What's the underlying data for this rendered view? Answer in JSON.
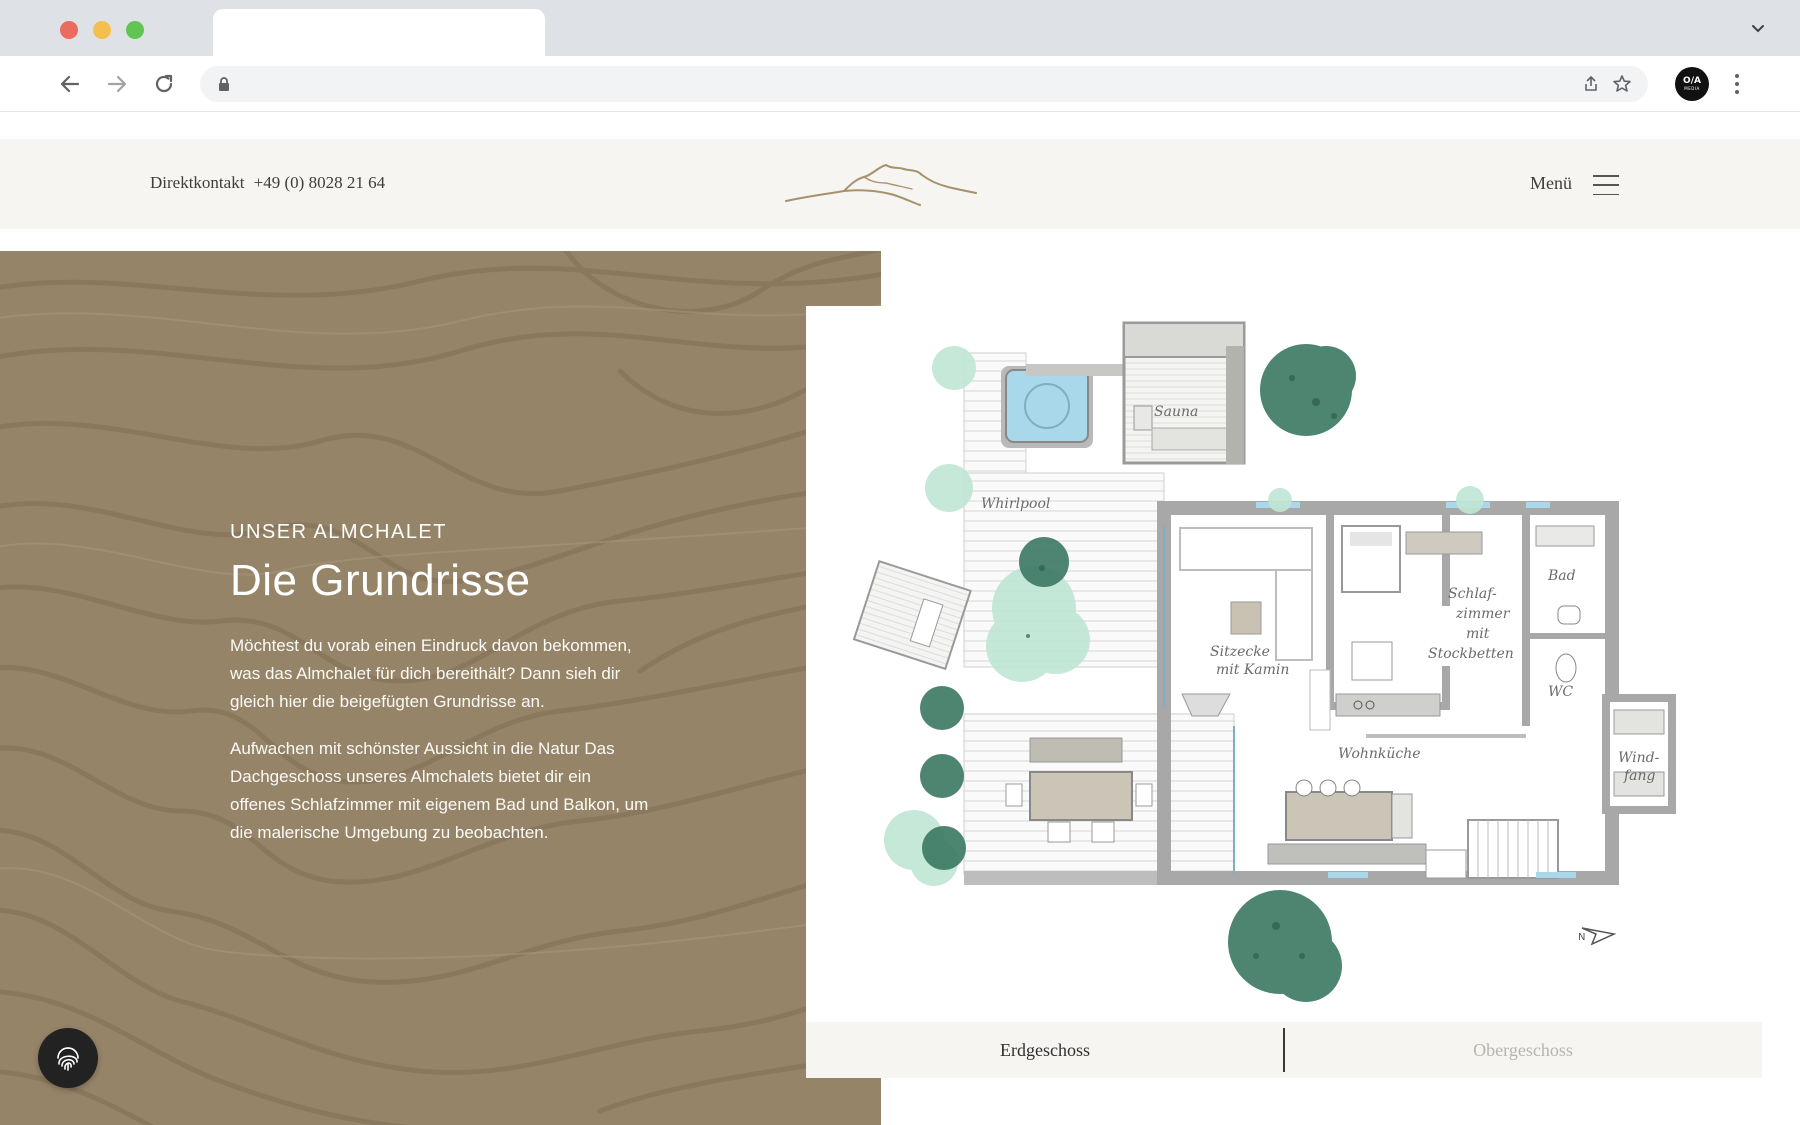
{
  "browser": {
    "profile_initials": "O/A",
    "profile_sub": "MEDIA"
  },
  "header": {
    "contact_label": "Direktkontakt",
    "contact_phone": "+49 (0) 8028 21 64",
    "menu_label": "Menü"
  },
  "intro": {
    "eyebrow": "UNSER ALMCHALET",
    "headline": "Die Grundrisse",
    "paragraph_1": "Möchtest du vorab einen Eindruck davon bekommen, was das Almchalet für dich bereithält? Dann sieh dir gleich hier die beigefügten Grundrisse an.",
    "paragraph_2": "Aufwachen mit schönster Aussicht in die Natur Das Dachgeschoss unseres Almchalets bietet dir ein offenes Schlafzimmer mit eigenem Bad und Balkon, um die malerische Umgebung zu beobachten."
  },
  "floorplan": {
    "rooms": {
      "whirlpool": "Whirlpool",
      "sauna": "Sauna",
      "sitzecke_1": "Sitzecke",
      "sitzecke_2": "mit Kamin",
      "schlaf_1": "Schlaf-",
      "schlaf_2": "zimmer",
      "schlaf_3": "mit",
      "schlaf_4": "Stockbetten",
      "bad": "Bad",
      "wc": "WC",
      "wohnkueche": "Wohnküche",
      "windfang_1": "Wind-",
      "windfang_2": "fang",
      "north": "N"
    },
    "tabs": {
      "ground_floor": "Erdgeschoss",
      "upper_floor": "Obergeschoss"
    }
  },
  "colors": {
    "brown_panel": "#958468",
    "header_bg": "#f6f5f2",
    "tree_dark": "#3e7b66",
    "tree_light": "#bfe6d4",
    "water": "#a8d8ea"
  }
}
